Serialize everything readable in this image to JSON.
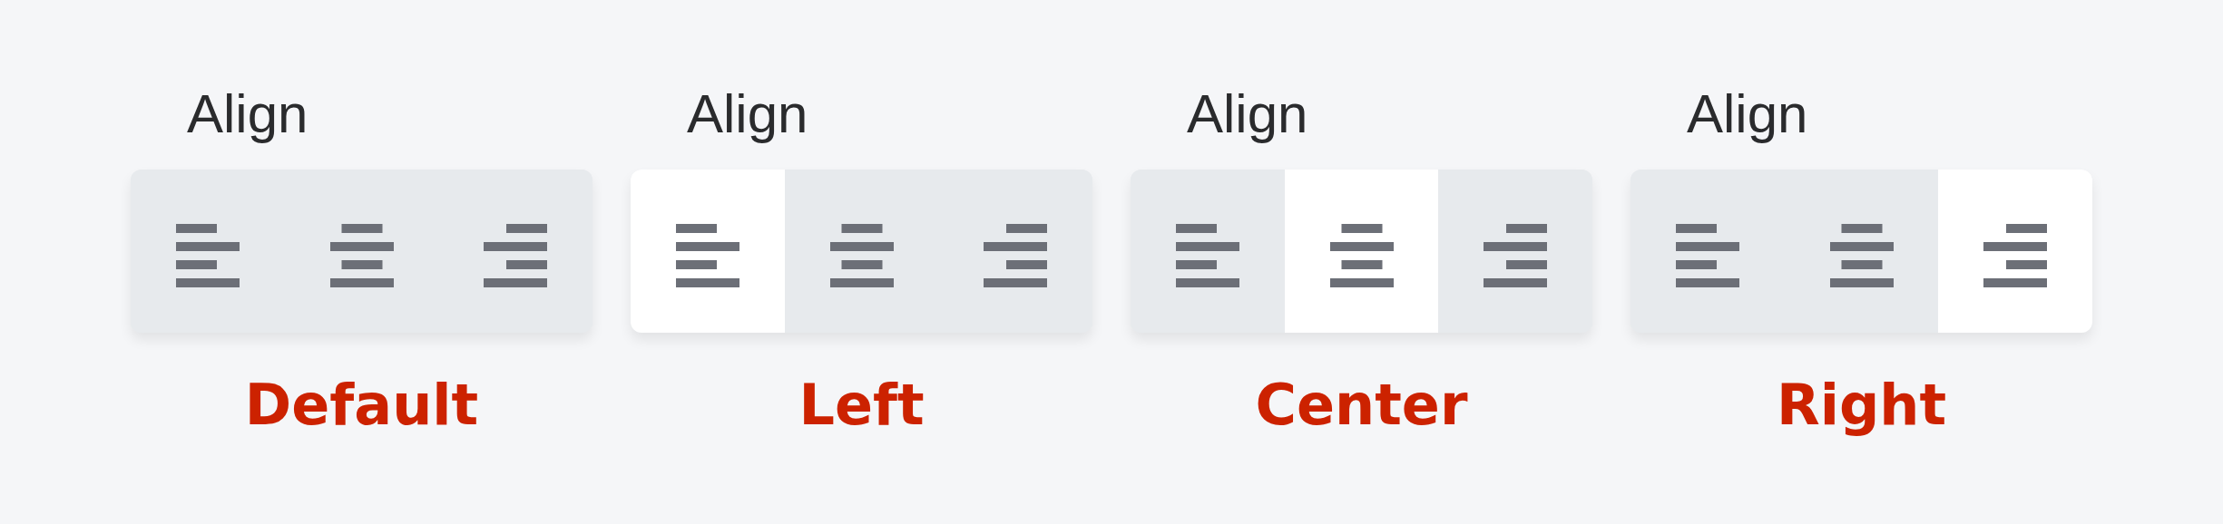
{
  "examples": [
    {
      "label": "Align",
      "options": [
        {
          "kind": "left",
          "selected": false
        },
        {
          "kind": "center",
          "selected": false
        },
        {
          "kind": "right",
          "selected": false
        }
      ],
      "caption": "Default"
    },
    {
      "label": "Align",
      "options": [
        {
          "kind": "left",
          "selected": true
        },
        {
          "kind": "center",
          "selected": false
        },
        {
          "kind": "right",
          "selected": false
        }
      ],
      "caption": "Left"
    },
    {
      "label": "Align",
      "options": [
        {
          "kind": "left",
          "selected": false
        },
        {
          "kind": "center",
          "selected": true
        },
        {
          "kind": "right",
          "selected": false
        }
      ],
      "caption": "Center"
    },
    {
      "label": "Align",
      "options": [
        {
          "kind": "left",
          "selected": false
        },
        {
          "kind": "center",
          "selected": false
        },
        {
          "kind": "right",
          "selected": true
        }
      ],
      "caption": "Right"
    }
  ]
}
